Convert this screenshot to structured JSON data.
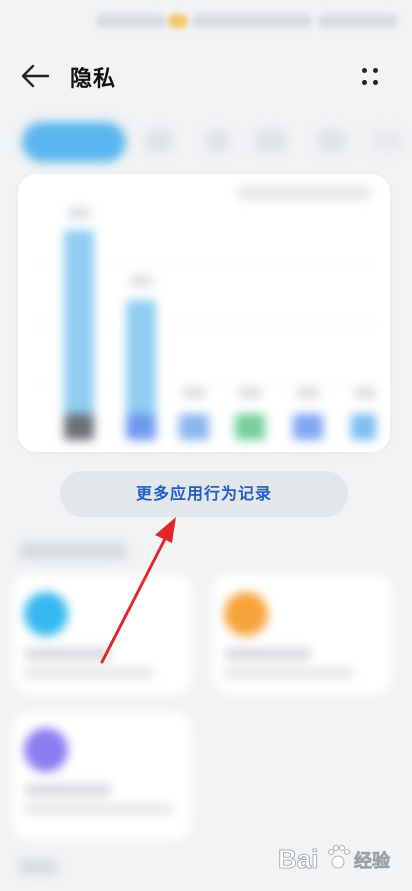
{
  "header": {
    "title": "隐私",
    "back_icon": "back-arrow-icon",
    "more_icon": "more-vertical-icon"
  },
  "main": {
    "more_records_button": "更多应用行为记录",
    "chart_colors": {
      "bar_top": "#5ab6ef",
      "bar_gray": "#6c6f74",
      "bar_blue": "#5f8ff0",
      "bar_light_blue": "#78b6f2",
      "bar_green": "#59c98a"
    },
    "cards": [
      {
        "icon_color": "#35b8f0"
      },
      {
        "icon_color": "#f7a23a"
      },
      {
        "icon_color": "#8c7cf2"
      }
    ]
  },
  "colors": {
    "background": "#f1f3f5",
    "accent_text": "#1f5fc4",
    "annotation_arrow": "#e2262b"
  },
  "watermark": {
    "text": "Bai",
    "suffix": "经验"
  }
}
